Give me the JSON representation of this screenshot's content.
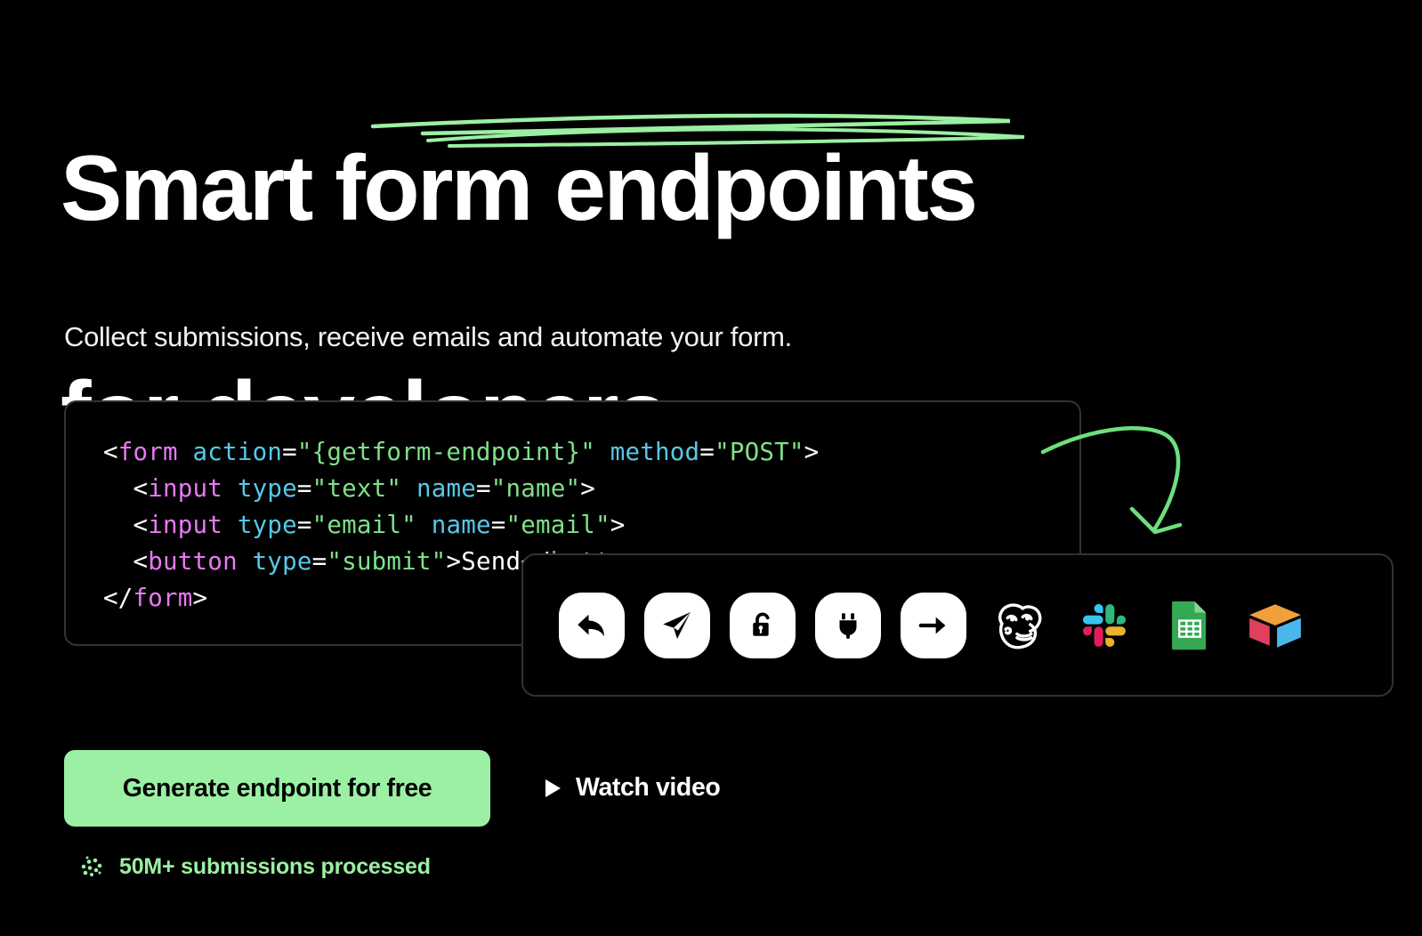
{
  "hero": {
    "headline_line1": "Smart form endpoints",
    "headline_line2": "for developers.",
    "subtitle": "Collect submissions, receive emails and automate your form.",
    "underline_doodle_name": "green-underline-doodle",
    "arrow_doodle_name": "green-curved-arrow-doodle",
    "accent_color": "#9BF0A4",
    "background_color": "#000000"
  },
  "code_block": {
    "language": "html",
    "lines": [
      "<form action=\"{getform-endpoint}\" method=\"POST\">",
      "  <input type=\"text\" name=\"name\">",
      "  <input type=\"email\" name=\"email\">",
      "  <button type=\"submit\">Send</button>",
      "</form>"
    ],
    "tokens": {
      "form_open_punct_lt": "<",
      "form_tag": "form",
      "action_attr": " action",
      "eq": "=",
      "action_value": "\"{getform-endpoint}\"",
      "method_attr": " method",
      "method_value": "\"POST\"",
      "punct_gt": ">",
      "input_tag": "input",
      "type_attr": "type",
      "type_text_value": "\"text\"",
      "name_attr": "name",
      "name_value": "\"name\"",
      "type_email_value": "\"email\"",
      "email_value": "\"email\"",
      "button_tag": "button",
      "type_submit_value": "\"submit\"",
      "button_text": "Send",
      "form_close": "</form>"
    }
  },
  "integrations": {
    "items": [
      {
        "name": "reply-icon",
        "label": "Reply",
        "style": "chip"
      },
      {
        "name": "send-icon",
        "label": "Send",
        "style": "chip"
      },
      {
        "name": "unlock-icon",
        "label": "Unlock",
        "style": "chip"
      },
      {
        "name": "plug-icon",
        "label": "Plug",
        "style": "chip"
      },
      {
        "name": "arrow-right-icon",
        "label": "Forward",
        "style": "chip"
      },
      {
        "name": "mailchimp-icon",
        "label": "Mailchimp",
        "style": "brand"
      },
      {
        "name": "slack-icon",
        "label": "Slack",
        "style": "brand"
      },
      {
        "name": "google-sheets-icon",
        "label": "Google Sheets",
        "style": "brand"
      },
      {
        "name": "airtable-icon",
        "label": "Airtable",
        "style": "brand"
      }
    ],
    "brand_colors": {
      "slack_blue": "#36C5F0",
      "slack_green": "#2EB67D",
      "slack_red": "#E01E5A",
      "slack_yellow": "#ECB22E",
      "sheets_green": "#34A853",
      "airtable_yellow": "#F0A03B",
      "airtable_red": "#E0405E",
      "airtable_blue": "#4BB6EB"
    }
  },
  "cta": {
    "primary_label": "Generate endpoint for free",
    "secondary_label": "Watch video",
    "play_icon_name": "play-triangle-icon"
  },
  "stat": {
    "icon_name": "dots-cluster-icon",
    "label": "50M+ submissions processed"
  }
}
